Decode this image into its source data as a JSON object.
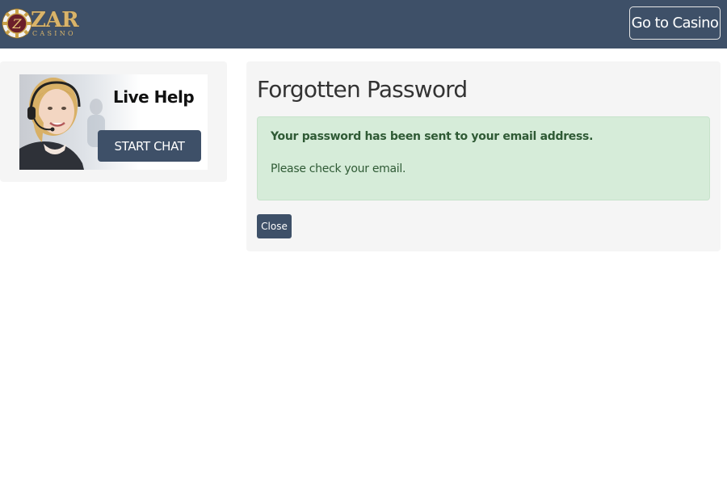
{
  "header": {
    "logo_text": "ZAR",
    "logo_subtext": "CASINO",
    "go_casino_label": "Go to Casino",
    "background_color": "#3e5068"
  },
  "sidebar": {
    "banner_title": "Live Help",
    "start_chat_label": "START CHAT"
  },
  "main": {
    "title": "Forgotten Password",
    "alert": {
      "title": "Your password has been sent to your email address.",
      "message": "Please check your email.",
      "color": "#d6ecd9"
    },
    "close_label": "Close"
  },
  "icons": {
    "logo": "casino-chip-icon",
    "support_photo": "support-agent-photo"
  }
}
